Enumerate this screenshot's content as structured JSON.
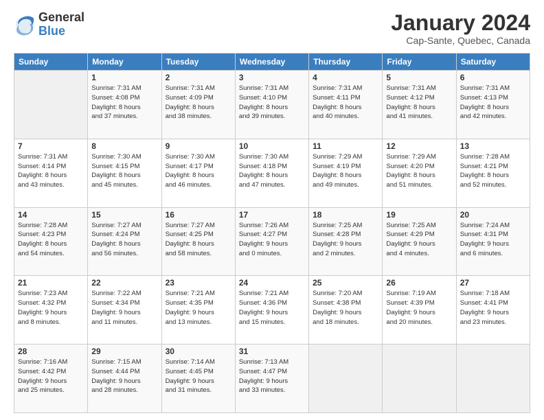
{
  "header": {
    "logo_general": "General",
    "logo_blue": "Blue",
    "month_title": "January 2024",
    "location": "Cap-Sante, Quebec, Canada"
  },
  "days_of_week": [
    "Sunday",
    "Monday",
    "Tuesday",
    "Wednesday",
    "Thursday",
    "Friday",
    "Saturday"
  ],
  "weeks": [
    [
      {
        "day": "",
        "sunrise": "",
        "sunset": "",
        "daylight": ""
      },
      {
        "day": "1",
        "sunrise": "Sunrise: 7:31 AM",
        "sunset": "Sunset: 4:08 PM",
        "daylight": "Daylight: 8 hours and 37 minutes."
      },
      {
        "day": "2",
        "sunrise": "Sunrise: 7:31 AM",
        "sunset": "Sunset: 4:09 PM",
        "daylight": "Daylight: 8 hours and 38 minutes."
      },
      {
        "day": "3",
        "sunrise": "Sunrise: 7:31 AM",
        "sunset": "Sunset: 4:10 PM",
        "daylight": "Daylight: 8 hours and 39 minutes."
      },
      {
        "day": "4",
        "sunrise": "Sunrise: 7:31 AM",
        "sunset": "Sunset: 4:11 PM",
        "daylight": "Daylight: 8 hours and 40 minutes."
      },
      {
        "day": "5",
        "sunrise": "Sunrise: 7:31 AM",
        "sunset": "Sunset: 4:12 PM",
        "daylight": "Daylight: 8 hours and 41 minutes."
      },
      {
        "day": "6",
        "sunrise": "Sunrise: 7:31 AM",
        "sunset": "Sunset: 4:13 PM",
        "daylight": "Daylight: 8 hours and 42 minutes."
      }
    ],
    [
      {
        "day": "7",
        "sunrise": "Sunrise: 7:31 AM",
        "sunset": "Sunset: 4:14 PM",
        "daylight": "Daylight: 8 hours and 43 minutes."
      },
      {
        "day": "8",
        "sunrise": "Sunrise: 7:30 AM",
        "sunset": "Sunset: 4:15 PM",
        "daylight": "Daylight: 8 hours and 45 minutes."
      },
      {
        "day": "9",
        "sunrise": "Sunrise: 7:30 AM",
        "sunset": "Sunset: 4:17 PM",
        "daylight": "Daylight: 8 hours and 46 minutes."
      },
      {
        "day": "10",
        "sunrise": "Sunrise: 7:30 AM",
        "sunset": "Sunset: 4:18 PM",
        "daylight": "Daylight: 8 hours and 47 minutes."
      },
      {
        "day": "11",
        "sunrise": "Sunrise: 7:29 AM",
        "sunset": "Sunset: 4:19 PM",
        "daylight": "Daylight: 8 hours and 49 minutes."
      },
      {
        "day": "12",
        "sunrise": "Sunrise: 7:29 AM",
        "sunset": "Sunset: 4:20 PM",
        "daylight": "Daylight: 8 hours and 51 minutes."
      },
      {
        "day": "13",
        "sunrise": "Sunrise: 7:28 AM",
        "sunset": "Sunset: 4:21 PM",
        "daylight": "Daylight: 8 hours and 52 minutes."
      }
    ],
    [
      {
        "day": "14",
        "sunrise": "Sunrise: 7:28 AM",
        "sunset": "Sunset: 4:23 PM",
        "daylight": "Daylight: 8 hours and 54 minutes."
      },
      {
        "day": "15",
        "sunrise": "Sunrise: 7:27 AM",
        "sunset": "Sunset: 4:24 PM",
        "daylight": "Daylight: 8 hours and 56 minutes."
      },
      {
        "day": "16",
        "sunrise": "Sunrise: 7:27 AM",
        "sunset": "Sunset: 4:25 PM",
        "daylight": "Daylight: 8 hours and 58 minutes."
      },
      {
        "day": "17",
        "sunrise": "Sunrise: 7:26 AM",
        "sunset": "Sunset: 4:27 PM",
        "daylight": "Daylight: 9 hours and 0 minutes."
      },
      {
        "day": "18",
        "sunrise": "Sunrise: 7:25 AM",
        "sunset": "Sunset: 4:28 PM",
        "daylight": "Daylight: 9 hours and 2 minutes."
      },
      {
        "day": "19",
        "sunrise": "Sunrise: 7:25 AM",
        "sunset": "Sunset: 4:29 PM",
        "daylight": "Daylight: 9 hours and 4 minutes."
      },
      {
        "day": "20",
        "sunrise": "Sunrise: 7:24 AM",
        "sunset": "Sunset: 4:31 PM",
        "daylight": "Daylight: 9 hours and 6 minutes."
      }
    ],
    [
      {
        "day": "21",
        "sunrise": "Sunrise: 7:23 AM",
        "sunset": "Sunset: 4:32 PM",
        "daylight": "Daylight: 9 hours and 8 minutes."
      },
      {
        "day": "22",
        "sunrise": "Sunrise: 7:22 AM",
        "sunset": "Sunset: 4:34 PM",
        "daylight": "Daylight: 9 hours and 11 minutes."
      },
      {
        "day": "23",
        "sunrise": "Sunrise: 7:21 AM",
        "sunset": "Sunset: 4:35 PM",
        "daylight": "Daylight: 9 hours and 13 minutes."
      },
      {
        "day": "24",
        "sunrise": "Sunrise: 7:21 AM",
        "sunset": "Sunset: 4:36 PM",
        "daylight": "Daylight: 9 hours and 15 minutes."
      },
      {
        "day": "25",
        "sunrise": "Sunrise: 7:20 AM",
        "sunset": "Sunset: 4:38 PM",
        "daylight": "Daylight: 9 hours and 18 minutes."
      },
      {
        "day": "26",
        "sunrise": "Sunrise: 7:19 AM",
        "sunset": "Sunset: 4:39 PM",
        "daylight": "Daylight: 9 hours and 20 minutes."
      },
      {
        "day": "27",
        "sunrise": "Sunrise: 7:18 AM",
        "sunset": "Sunset: 4:41 PM",
        "daylight": "Daylight: 9 hours and 23 minutes."
      }
    ],
    [
      {
        "day": "28",
        "sunrise": "Sunrise: 7:16 AM",
        "sunset": "Sunset: 4:42 PM",
        "daylight": "Daylight: 9 hours and 25 minutes."
      },
      {
        "day": "29",
        "sunrise": "Sunrise: 7:15 AM",
        "sunset": "Sunset: 4:44 PM",
        "daylight": "Daylight: 9 hours and 28 minutes."
      },
      {
        "day": "30",
        "sunrise": "Sunrise: 7:14 AM",
        "sunset": "Sunset: 4:45 PM",
        "daylight": "Daylight: 9 hours and 31 minutes."
      },
      {
        "day": "31",
        "sunrise": "Sunrise: 7:13 AM",
        "sunset": "Sunset: 4:47 PM",
        "daylight": "Daylight: 9 hours and 33 minutes."
      },
      {
        "day": "",
        "sunrise": "",
        "sunset": "",
        "daylight": ""
      },
      {
        "day": "",
        "sunrise": "",
        "sunset": "",
        "daylight": ""
      },
      {
        "day": "",
        "sunrise": "",
        "sunset": "",
        "daylight": ""
      }
    ]
  ]
}
